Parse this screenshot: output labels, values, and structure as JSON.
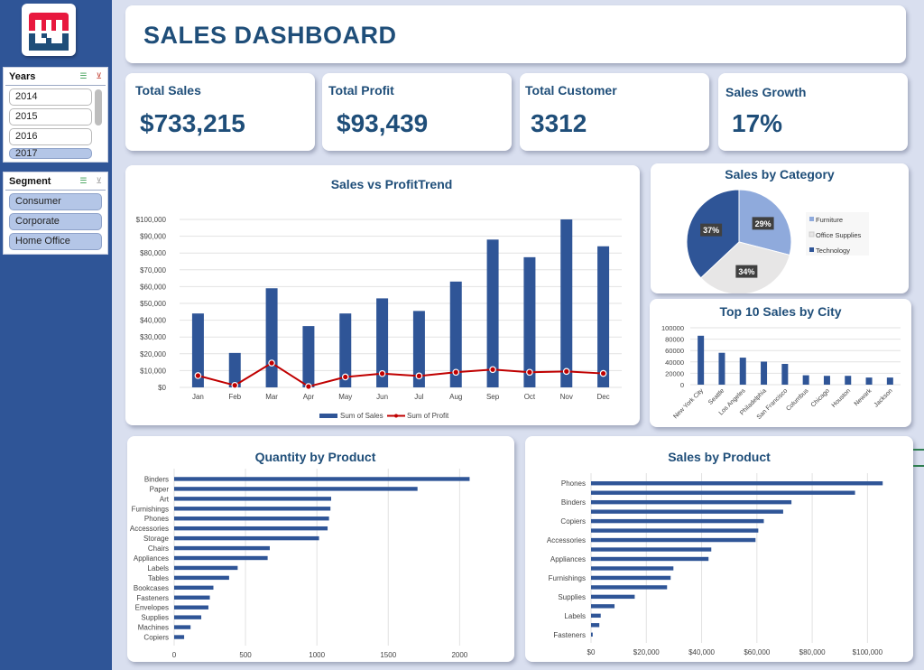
{
  "sidebar": {
    "logo": "brand-logo",
    "slicers": [
      {
        "title": "Years",
        "items": [
          {
            "label": "2014",
            "selected": false
          },
          {
            "label": "2015",
            "selected": false
          },
          {
            "label": "2016",
            "selected": false
          },
          {
            "label": "2017",
            "selected": true
          }
        ]
      },
      {
        "title": "Segment",
        "items": [
          {
            "label": "Consumer",
            "selected": true
          },
          {
            "label": "Corporate",
            "selected": true
          },
          {
            "label": "Home Office",
            "selected": true
          }
        ]
      }
    ]
  },
  "header": {
    "title": "SALES DASHBOARD"
  },
  "kpis": [
    {
      "label": "Total Sales",
      "value": "$733,215"
    },
    {
      "label": "Total Profit",
      "value": "$93,439"
    },
    {
      "label": "Total Customer",
      "value": "3312"
    },
    {
      "label": "Sales Growth",
      "value": "17%"
    }
  ],
  "colors": {
    "primary": "#2f5597",
    "title": "#1f4e79",
    "profit_line": "#c00000",
    "furniture": "#8faadc",
    "office_supplies": "#e7e6e6",
    "technology": "#2f5597"
  },
  "chart_data": [
    {
      "id": "sales-vs-profit",
      "type": "bar",
      "title": "Sales vs ProfitTrend",
      "categories": [
        "Jan",
        "Feb",
        "Mar",
        "Apr",
        "May",
        "Jun",
        "Jul",
        "Aug",
        "Sep",
        "Oct",
        "Nov",
        "Dec"
      ],
      "series": [
        {
          "name": "Sum of Sales",
          "kind": "bar",
          "values": [
            44000,
            20500,
            59000,
            36500,
            44000,
            53000,
            45500,
            63000,
            88000,
            77500,
            100000,
            84000
          ]
        },
        {
          "name": "Sum of Profit",
          "kind": "line",
          "values": [
            7000,
            1200,
            14500,
            500,
            6200,
            8200,
            6800,
            9000,
            10600,
            9000,
            9500,
            8300
          ]
        }
      ],
      "yticks": [
        "$0",
        "$10,000",
        "$20,000",
        "$30,000",
        "$40,000",
        "$50,000",
        "$60,000",
        "$70,000",
        "$80,000",
        "$90,000",
        "$100,000"
      ],
      "ylim": [
        0,
        100000
      ],
      "legend": "bottom",
      "grid": true
    },
    {
      "id": "sales-by-category",
      "type": "pie",
      "title": "Sales by Category",
      "labels": [
        "Furniture",
        "Office Supplies",
        "Technology"
      ],
      "values": [
        29,
        34,
        37
      ],
      "data_labels": [
        "29%",
        "34%",
        "37%"
      ],
      "legend": "right"
    },
    {
      "id": "top-cities",
      "type": "bar",
      "title": "Top 10 Sales by City",
      "categories": [
        "New York City",
        "Seattle",
        "Los Angeles",
        "Philadelphia",
        "San Francisco",
        "Columbus",
        "Chicago",
        "Houston",
        "Newark",
        "Jackson"
      ],
      "values": [
        86000,
        56000,
        47500,
        40500,
        36500,
        16500,
        15500,
        15500,
        12500,
        12500
      ],
      "yticks": [
        "0",
        "20000",
        "40000",
        "60000",
        "80000",
        "100000"
      ],
      "ylim": [
        0,
        100000
      ],
      "grid": true
    },
    {
      "id": "quantity-by-product",
      "type": "bar",
      "orientation": "horizontal",
      "title": "Quantity by Product",
      "categories": [
        "Binders",
        "Paper",
        "Art",
        "Furnishings",
        "Phones",
        "Accessories",
        "Storage",
        "Chairs",
        "Appliances",
        "Labels",
        "Tables",
        "Bookcases",
        "Fasteners",
        "Envelopes",
        "Supplies",
        "Machines",
        "Copiers"
      ],
      "values": [
        2070,
        1705,
        1100,
        1095,
        1085,
        1075,
        1015,
        670,
        655,
        445,
        385,
        275,
        250,
        240,
        190,
        115,
        70
      ],
      "xticks": [
        "0",
        "500",
        "1000",
        "1500",
        "2000"
      ],
      "xlim": [
        0,
        2200
      ],
      "grid": true
    },
    {
      "id": "sales-by-product",
      "type": "bar",
      "orientation": "horizontal",
      "title": "Sales by Product",
      "categories": [
        "Phones",
        "",
        "Binders",
        "",
        "Copiers",
        "",
        "Accessories",
        "",
        "Appliances",
        "",
        "Furnishings",
        "",
        "Supplies",
        "",
        "Labels",
        "",
        "Fasteners"
      ],
      "values": [
        105500,
        95500,
        72500,
        69500,
        62500,
        60500,
        59500,
        43500,
        42500,
        29800,
        28800,
        27500,
        15800,
        8500,
        3500,
        3000,
        600
      ],
      "xticks": [
        "$0",
        "$20,000",
        "$40,000",
        "$60,000",
        "$80,000",
        "$100,000"
      ],
      "xlim": [
        0,
        110000
      ],
      "grid": true
    }
  ]
}
